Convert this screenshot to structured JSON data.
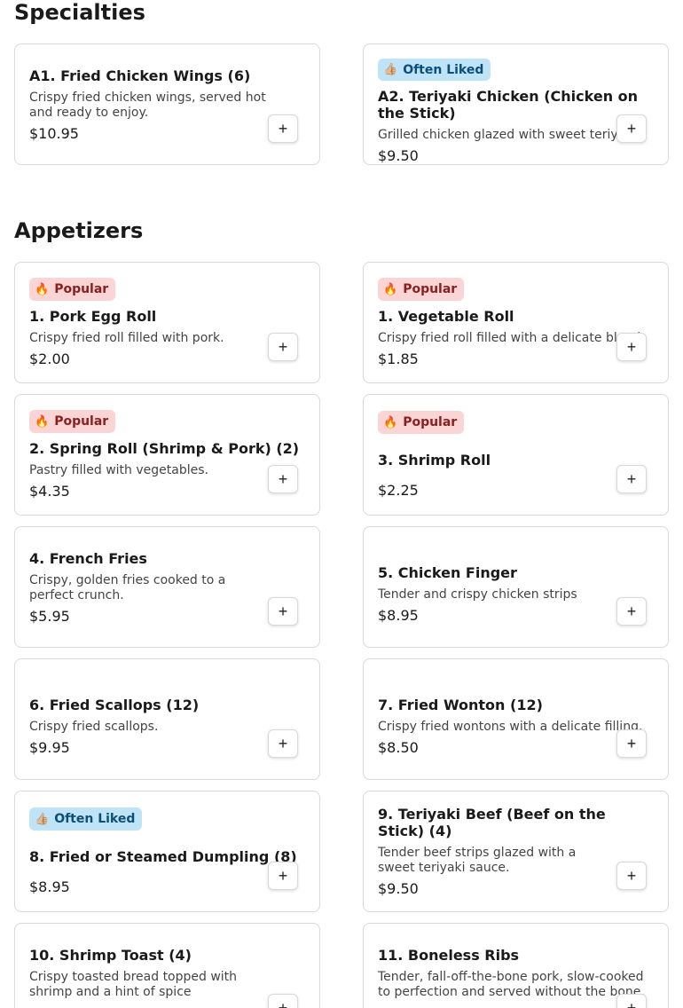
{
  "sections": {
    "specialties": "Specialties",
    "appetizers": "Appetizers"
  },
  "badges": {
    "popular": "Popular",
    "often_liked": "Often Liked",
    "popular_icon": "flame-icon",
    "often_liked_icon": "thumbs-up-icon"
  },
  "add_label": "+",
  "items": [
    {
      "name": "A1. Fried Chicken Wings (6)",
      "desc": "Crispy fried chicken wings, served hot and ready to enjoy.",
      "price": "$10.95",
      "badge": ""
    },
    {
      "name": "A2. Teriyaki Chicken (Chicken on the Stick)",
      "desc": "Grilled chicken glazed with sweet teriyaki.",
      "price": "$9.50",
      "badge": "often_liked"
    },
    {
      "name": "1. Pork Egg Roll",
      "desc": "Crispy fried roll filled with pork.",
      "price": "$2.00",
      "badge": "popular"
    },
    {
      "name": "1. Vegetable Roll",
      "desc": "Crispy fried roll filled with a delicate blend.",
      "price": "$1.85",
      "badge": "popular"
    },
    {
      "name": "2. Spring Roll (Shrimp & Pork) (2)",
      "desc": "Pastry filled with vegetables.",
      "price": "$4.35",
      "badge": "popular"
    },
    {
      "name": "3. Shrimp Roll",
      "desc": "",
      "price": "$2.25",
      "badge": "popular"
    },
    {
      "name": "4. French Fries",
      "desc": "Crispy, golden fries cooked to a perfect crunch.",
      "price": "$5.95",
      "badge": ""
    },
    {
      "name": "5. Chicken Finger",
      "desc": "Tender and crispy chicken strips",
      "price": "$8.95",
      "badge": ""
    },
    {
      "name": "6. Fried Scallops (12)",
      "desc": "Crispy fried scallops.",
      "price": "$9.95",
      "badge": ""
    },
    {
      "name": "7. Fried Wonton (12)",
      "desc": "Crispy fried wontons with a delicate filling.",
      "price": "$8.50",
      "badge": ""
    },
    {
      "name": "8. Fried or Steamed Dumpling (8)",
      "desc": "",
      "price": "$8.95",
      "badge": "often_liked"
    },
    {
      "name": "9. Teriyaki Beef (Beef on the Stick) (4)",
      "desc": "Tender beef strips glazed with a sweet teriyaki sauce.",
      "price": "$9.50",
      "badge": ""
    },
    {
      "name": "10. Shrimp Toast (4)",
      "desc": "Crispy toasted bread topped with shrimp and a hint of spice",
      "price": "",
      "badge": ""
    },
    {
      "name": "11. Boneless Ribs",
      "desc": "Tender, fall-off-the-bone pork, slow-cooked to perfection and served without the bone.",
      "price": "",
      "badge": ""
    }
  ]
}
